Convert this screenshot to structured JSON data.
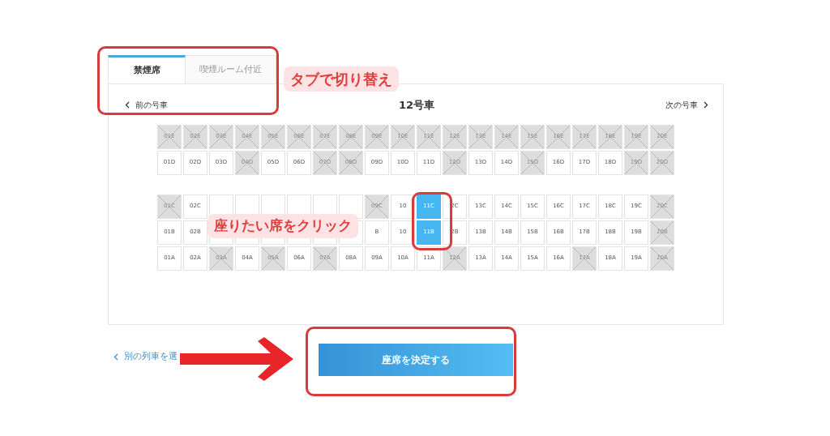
{
  "tabs": [
    {
      "label": "禁煙席",
      "selected": true
    },
    {
      "label": "喫煙ルーム付近",
      "selected": false
    }
  ],
  "car_nav": {
    "prev": "前の号車",
    "title": "12号車",
    "next": "次の号車"
  },
  "seat_rows": [
    {
      "seats": [
        {
          "label": "01E",
          "taken": true,
          "selected": false
        },
        {
          "label": "02E",
          "taken": true,
          "selected": false
        },
        {
          "label": "03E",
          "taken": true,
          "selected": false
        },
        {
          "label": "04E",
          "taken": true,
          "selected": false
        },
        {
          "label": "05E",
          "taken": true,
          "selected": false
        },
        {
          "label": "06E",
          "taken": true,
          "selected": false
        },
        {
          "label": "07E",
          "taken": true,
          "selected": false
        },
        {
          "label": "08E",
          "taken": true,
          "selected": false
        },
        {
          "label": "09E",
          "taken": true,
          "selected": false
        },
        {
          "label": "10E",
          "taken": true,
          "selected": false
        },
        {
          "label": "11E",
          "taken": true,
          "selected": false
        },
        {
          "label": "12E",
          "taken": true,
          "selected": false
        },
        {
          "label": "13E",
          "taken": true,
          "selected": false
        },
        {
          "label": "14E",
          "taken": true,
          "selected": false
        },
        {
          "label": "15E",
          "taken": true,
          "selected": false
        },
        {
          "label": "16E",
          "taken": true,
          "selected": false
        },
        {
          "label": "17E",
          "taken": true,
          "selected": false
        },
        {
          "label": "18E",
          "taken": true,
          "selected": false
        },
        {
          "label": "19E",
          "taken": true,
          "selected": false
        },
        {
          "label": "20E",
          "taken": true,
          "selected": false
        }
      ]
    },
    {
      "seats": [
        {
          "label": "01D",
          "taken": false,
          "selected": false
        },
        {
          "label": "02D",
          "taken": false,
          "selected": false
        },
        {
          "label": "03D",
          "taken": false,
          "selected": false
        },
        {
          "label": "04D",
          "taken": true,
          "selected": false
        },
        {
          "label": "05D",
          "taken": false,
          "selected": false
        },
        {
          "label": "06D",
          "taken": false,
          "selected": false
        },
        {
          "label": "07D",
          "taken": true,
          "selected": false
        },
        {
          "label": "08D",
          "taken": true,
          "selected": false
        },
        {
          "label": "09D",
          "taken": false,
          "selected": false
        },
        {
          "label": "10D",
          "taken": false,
          "selected": false
        },
        {
          "label": "11D",
          "taken": false,
          "selected": false
        },
        {
          "label": "12D",
          "taken": true,
          "selected": false
        },
        {
          "label": "13D",
          "taken": false,
          "selected": false
        },
        {
          "label": "14D",
          "taken": false,
          "selected": false
        },
        {
          "label": "15D",
          "taken": true,
          "selected": false
        },
        {
          "label": "16D",
          "taken": false,
          "selected": false
        },
        {
          "label": "17D",
          "taken": false,
          "selected": false
        },
        {
          "label": "18D",
          "taken": false,
          "selected": false
        },
        {
          "label": "19D",
          "taken": true,
          "selected": false
        },
        {
          "label": "20D",
          "taken": true,
          "selected": false
        }
      ]
    },
    {
      "seats": [
        {
          "label": "01C",
          "taken": true,
          "selected": false
        },
        {
          "label": "02C",
          "taken": false,
          "selected": false
        },
        {
          "taken": false,
          "selected": false
        },
        {
          "taken": false,
          "selected": false
        },
        {
          "taken": false,
          "selected": false
        },
        {
          "taken": false,
          "selected": false
        },
        {
          "taken": false,
          "selected": false
        },
        {
          "taken": false,
          "selected": false
        },
        {
          "label": "09C",
          "taken": true,
          "selected": false
        },
        {
          "label": "10",
          "taken": false,
          "selected": false
        },
        {
          "label": "11C",
          "taken": false,
          "selected": true
        },
        {
          "label": "2C",
          "taken": false,
          "selected": false
        },
        {
          "label": "13C",
          "taken": false,
          "selected": false
        },
        {
          "label": "14C",
          "taken": false,
          "selected": false
        },
        {
          "label": "15C",
          "taken": false,
          "selected": false
        },
        {
          "label": "16C",
          "taken": false,
          "selected": false
        },
        {
          "label": "17C",
          "taken": false,
          "selected": false
        },
        {
          "label": "18C",
          "taken": false,
          "selected": false
        },
        {
          "label": "19C",
          "taken": false,
          "selected": false
        },
        {
          "label": "20C",
          "taken": true,
          "selected": false
        }
      ]
    },
    {
      "seats": [
        {
          "label": "01B",
          "taken": false,
          "selected": false
        },
        {
          "label": "02B",
          "taken": false,
          "selected": false
        },
        {
          "taken": false,
          "selected": false
        },
        {
          "taken": false,
          "selected": false
        },
        {
          "taken": false,
          "selected": false
        },
        {
          "taken": false,
          "selected": false
        },
        {
          "taken": false,
          "selected": false
        },
        {
          "taken": false,
          "selected": false
        },
        {
          "label": "B",
          "taken": false,
          "selected": false
        },
        {
          "label": "10",
          "taken": false,
          "selected": false
        },
        {
          "label": "11B",
          "taken": false,
          "selected": true
        },
        {
          "label": "2B",
          "taken": false,
          "selected": false
        },
        {
          "label": "13B",
          "taken": false,
          "selected": false
        },
        {
          "label": "14B",
          "taken": false,
          "selected": false
        },
        {
          "label": "15B",
          "taken": false,
          "selected": false
        },
        {
          "label": "16B",
          "taken": false,
          "selected": false
        },
        {
          "label": "17B",
          "taken": false,
          "selected": false
        },
        {
          "label": "18B",
          "taken": false,
          "selected": false
        },
        {
          "label": "19B",
          "taken": false,
          "selected": false
        },
        {
          "label": "20B",
          "taken": true,
          "selected": false
        }
      ]
    },
    {
      "seats": [
        {
          "label": "01A",
          "taken": false,
          "selected": false
        },
        {
          "label": "02A",
          "taken": false,
          "selected": false
        },
        {
          "label": "03A",
          "taken": true,
          "selected": false
        },
        {
          "label": "04A",
          "taken": false,
          "selected": false
        },
        {
          "label": "05A",
          "taken": true,
          "selected": false
        },
        {
          "label": "06A",
          "taken": false,
          "selected": false
        },
        {
          "label": "07A",
          "taken": true,
          "selected": false
        },
        {
          "label": "08A",
          "taken": false,
          "selected": false
        },
        {
          "label": "09A",
          "taken": false,
          "selected": false
        },
        {
          "label": "10A",
          "taken": false,
          "selected": false
        },
        {
          "label": "11A",
          "taken": false,
          "selected": false
        },
        {
          "label": "12A",
          "taken": true,
          "selected": false
        },
        {
          "label": "13A",
          "taken": false,
          "selected": false
        },
        {
          "label": "14A",
          "taken": false,
          "selected": false
        },
        {
          "label": "15A",
          "taken": false,
          "selected": false
        },
        {
          "label": "16A",
          "taken": false,
          "selected": false
        },
        {
          "label": "17A",
          "taken": true,
          "selected": false
        },
        {
          "label": "18A",
          "taken": false,
          "selected": false
        },
        {
          "label": "19A",
          "taken": false,
          "selected": false
        },
        {
          "label": "20A",
          "taken": true,
          "selected": false
        }
      ]
    }
  ],
  "back_link": "別の列車を選",
  "confirm_button": "座席を決定する",
  "annotations": [
    {
      "kind": "frame"
    },
    {
      "kind": "callout",
      "text": "タブで切り替え"
    },
    {
      "kind": "callout",
      "text": "座りたい席をクリック"
    },
    {
      "kind": "frame"
    },
    {
      "kind": "frame"
    },
    {
      "kind": "arrow"
    }
  ]
}
